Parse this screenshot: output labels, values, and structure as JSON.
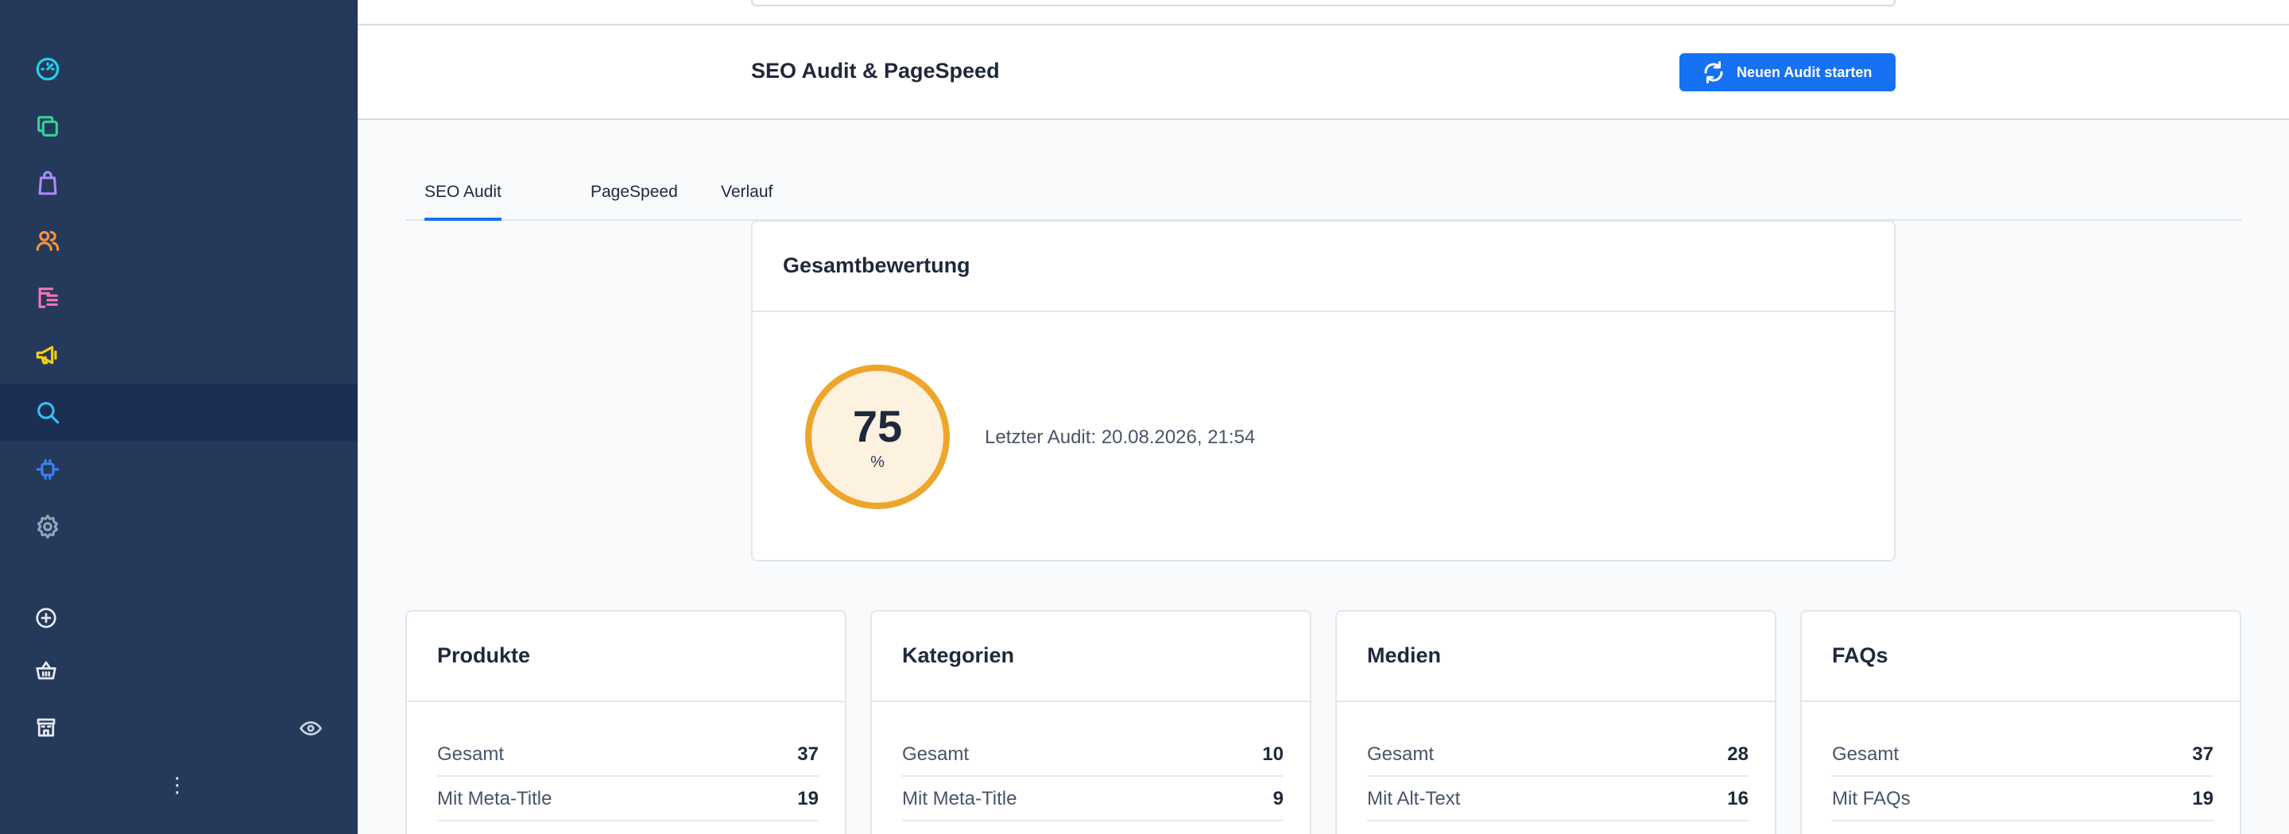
{
  "header": {
    "title": "SEO Audit & PageSpeed",
    "button_label": "Neuen Audit starten"
  },
  "tabs": [
    {
      "label": "SEO Audit",
      "active": true
    },
    {
      "label": "PageSpeed",
      "active": false
    },
    {
      "label": "Verlauf",
      "active": false
    }
  ],
  "score": {
    "title": "Gesamtbewertung",
    "value": "75",
    "unit": "%",
    "value_fraction": 0.75,
    "last_audit": "Letzter Audit: 20.08.2026, 21:54"
  },
  "cards": [
    {
      "title": "Produkte",
      "rows": [
        {
          "label": "Gesamt",
          "value": "37"
        },
        {
          "label": "Mit Meta-Title",
          "value": "19"
        }
      ]
    },
    {
      "title": "Kategorien",
      "rows": [
        {
          "label": "Gesamt",
          "value": "10"
        },
        {
          "label": "Mit Meta-Title",
          "value": "9"
        }
      ]
    },
    {
      "title": "Medien",
      "rows": [
        {
          "label": "Gesamt",
          "value": "28"
        },
        {
          "label": "Mit Alt-Text",
          "value": "16"
        }
      ]
    },
    {
      "title": "FAQs",
      "rows": [
        {
          "label": "Gesamt",
          "value": "37"
        },
        {
          "label": "Mit FAQs",
          "value": "19"
        }
      ]
    }
  ],
  "sidebar": {
    "icons": [
      "dashboard-icon",
      "copy-icon",
      "shopping-bag-icon",
      "users-icon",
      "list-icon",
      "megaphone-icon",
      "search-icon",
      "plug-icon",
      "gear-icon"
    ],
    "bottom_icons": [
      "plus-circle-icon",
      "basket-icon",
      "store-icon"
    ],
    "active": "search-icon",
    "icon_colors": [
      "#22d3ee",
      "#34d399",
      "#a78bfa",
      "#fb923c",
      "#f472b6",
      "#facc15",
      "#38bdf8",
      "#3b82f6",
      "#94a3b8"
    ]
  },
  "colors": {
    "accent": "#1672f3",
    "sidebar_bg": "#253a5a",
    "score_ring": "#eda52c"
  }
}
